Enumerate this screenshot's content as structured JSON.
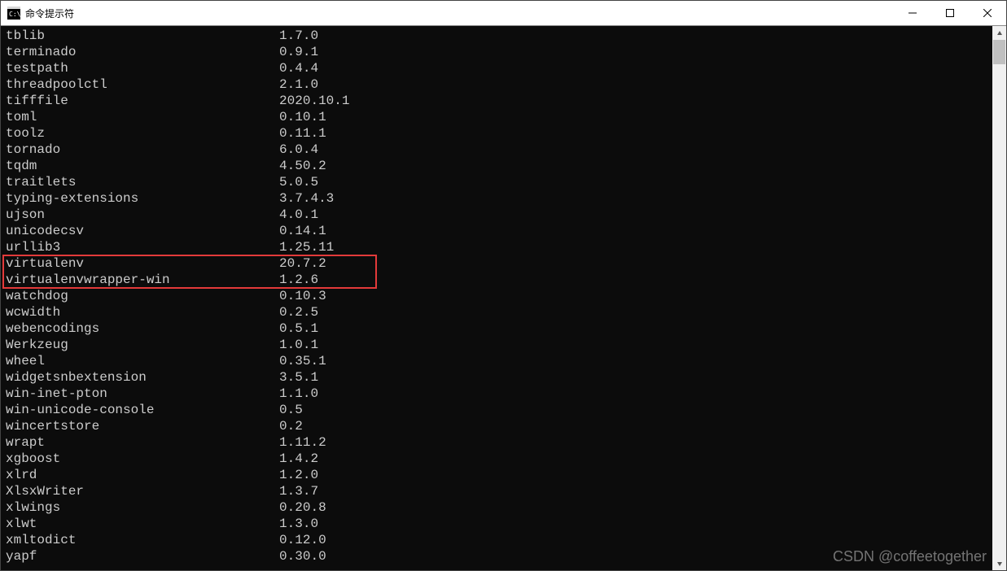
{
  "window": {
    "title": "命令提示符"
  },
  "highlight_rows": {
    "start": 12,
    "end": 13
  },
  "watermark": "CSDN @coffeetogether",
  "name_col_width": 35,
  "packages": [
    {
      "name": "tblib",
      "version": "1.7.0"
    },
    {
      "name": "terminado",
      "version": "0.9.1"
    },
    {
      "name": "testpath",
      "version": "0.4.4"
    },
    {
      "name": "threadpoolctl",
      "version": "2.1.0"
    },
    {
      "name": "tifffile",
      "version": "2020.10.1"
    },
    {
      "name": "toml",
      "version": "0.10.1"
    },
    {
      "name": "toolz",
      "version": "0.11.1"
    },
    {
      "name": "tornado",
      "version": "6.0.4"
    },
    {
      "name": "tqdm",
      "version": "4.50.2"
    },
    {
      "name": "traitlets",
      "version": "5.0.5"
    },
    {
      "name": "typing-extensions",
      "version": "3.7.4.3"
    },
    {
      "name": "ujson",
      "version": "4.0.1"
    },
    {
      "name": "unicodecsv",
      "version": "0.14.1"
    },
    {
      "name": "urllib3",
      "version": "1.25.11"
    },
    {
      "name": "virtualenv",
      "version": "20.7.2"
    },
    {
      "name": "virtualenvwrapper-win",
      "version": "1.2.6"
    },
    {
      "name": "watchdog",
      "version": "0.10.3"
    },
    {
      "name": "wcwidth",
      "version": "0.2.5"
    },
    {
      "name": "webencodings",
      "version": "0.5.1"
    },
    {
      "name": "Werkzeug",
      "version": "1.0.1"
    },
    {
      "name": "wheel",
      "version": "0.35.1"
    },
    {
      "name": "widgetsnbextension",
      "version": "3.5.1"
    },
    {
      "name": "win-inet-pton",
      "version": "1.1.0"
    },
    {
      "name": "win-unicode-console",
      "version": "0.5"
    },
    {
      "name": "wincertstore",
      "version": "0.2"
    },
    {
      "name": "wrapt",
      "version": "1.11.2"
    },
    {
      "name": "xgboost",
      "version": "1.4.2"
    },
    {
      "name": "xlrd",
      "version": "1.2.0"
    },
    {
      "name": "XlsxWriter",
      "version": "1.3.7"
    },
    {
      "name": "xlwings",
      "version": "0.20.8"
    },
    {
      "name": "xlwt",
      "version": "1.3.0"
    },
    {
      "name": "xmltodict",
      "version": "0.12.0"
    },
    {
      "name": "yapf",
      "version": "0.30.0"
    }
  ]
}
